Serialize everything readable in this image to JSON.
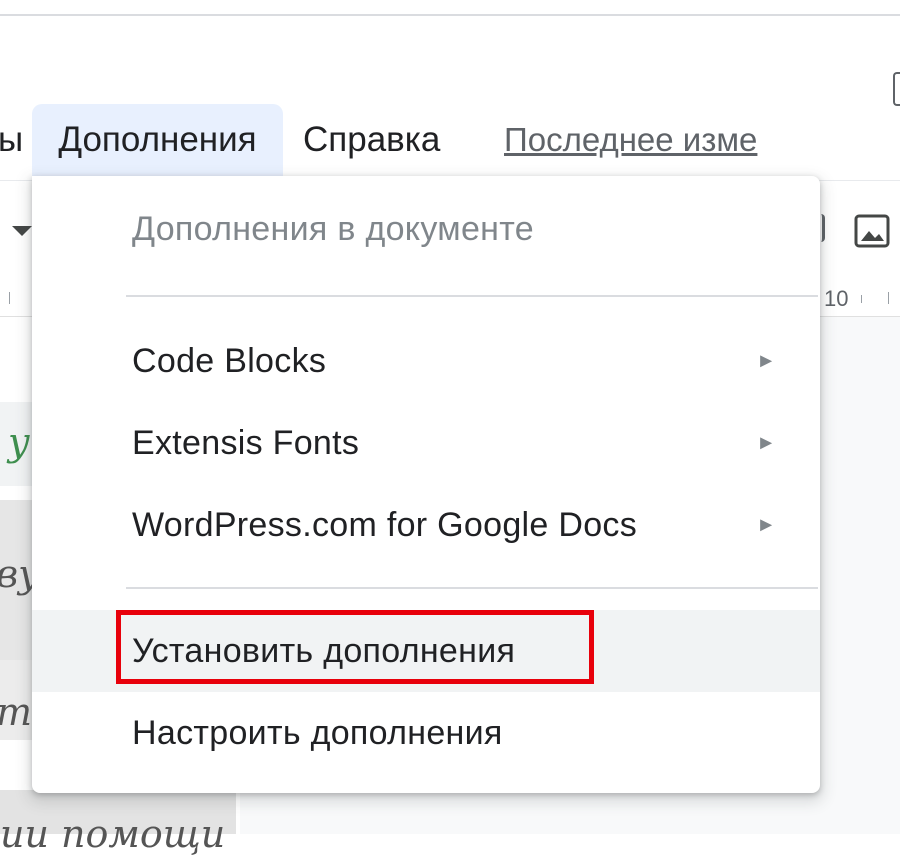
{
  "menubar": {
    "prev_fragment": "ы",
    "addons_label": "Дополнения",
    "help_label": "Справка",
    "last_edit_label": "Последнее изме"
  },
  "ruler": {
    "mark": "10"
  },
  "document": {
    "fragment1": "у",
    "fragment2": "ву",
    "fragment3": "ти",
    "fragment4": "ии помощи"
  },
  "dropdown": {
    "header": "Дополнения в документе",
    "items": [
      {
        "label": "Code Blocks",
        "submenu": true
      },
      {
        "label": "Extensis Fonts",
        "submenu": true
      },
      {
        "label": "WordPress.com for Google Docs",
        "submenu": true
      }
    ],
    "actions": [
      {
        "label": "Установить дополнения",
        "highlighted": true
      },
      {
        "label": "Настроить дополнения"
      }
    ],
    "arrow_glyph": "►"
  },
  "colors": {
    "active_menu_bg": "#e8f0fe",
    "highlight_border": "#e8000b",
    "hover_bg": "#f1f3f4",
    "handwriting_green": "#3f8f4f"
  }
}
